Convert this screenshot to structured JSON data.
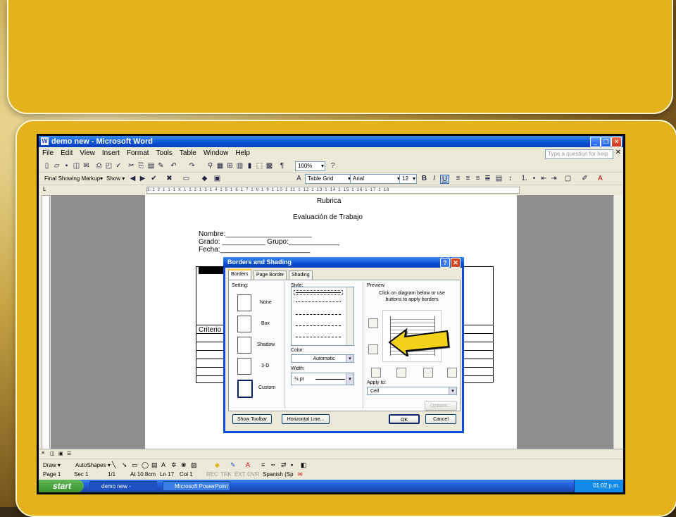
{
  "app": {
    "title": "demo new - Microsoft Word",
    "menu": [
      "File",
      "Edit",
      "View",
      "Insert",
      "Format",
      "Tools",
      "Table",
      "Window",
      "Help"
    ],
    "help_placeholder": "Type a question for help",
    "zoom": "100%",
    "markup_combo": "Final Showing Markup",
    "show_label": "Show ▾",
    "style_combo": "Table Grid",
    "font_combo": "Arial",
    "size_combo": "12",
    "ruler_text": "3·1·2·1·1·1·X·1·1·2·1·3·1·4·1·5·1·6·1·7·1·8·1·9·1·10·1·11·1·12·1·13·1·14·1·15·1·16·1·17·1·18"
  },
  "document": {
    "heading": "Rubrica",
    "subheading": "Evaluación de Trabajo",
    "line_nombre": "Nombre:______________________",
    "line_grado": "Grado: ___________ Grupo:_____________",
    "line_fecha": "Fecha:_______________________",
    "table_cell": "Criterio"
  },
  "dialog": {
    "title": "Borders and Shading",
    "tabs": [
      "Borders",
      "Page Border",
      "Shading"
    ],
    "setting_label": "Setting:",
    "settings": [
      "None",
      "Box",
      "Shadow",
      "3-D",
      "Custom"
    ],
    "style_label": "Style:",
    "color_label": "Color:",
    "color_value": "Automatic",
    "width_label": "Width:",
    "width_value": "½ pt",
    "preview_label": "Preview",
    "preview_help": "Click on diagram below or use buttons to apply borders",
    "apply_label": "Apply to:",
    "apply_value": "Cell",
    "options_button": "Options...",
    "show_toolbar_button": "Show Toolbar",
    "horizontal_line_button": "Horizontal Line...",
    "ok_button": "OK",
    "cancel_button": "Cancel"
  },
  "drawbar": {
    "draw_label": "Draw ▾",
    "autoshapes_label": "AutoShapes ▾"
  },
  "status": {
    "page": "Page 1",
    "sec": "Sec 1",
    "pages": "1/1",
    "at": "At 10.8cm",
    "ln": "Ln 17",
    "col": "Col 1",
    "rec": "REC",
    "trk": "TRK",
    "ext": "EXT",
    "ovr": "OVR",
    "lang": "Spanish (Sp"
  },
  "taskbar": {
    "start": "start",
    "task1": "demo new - Microsoft...",
    "task2": "Microsoft PowerPoint ...",
    "clock": "01:02 p.m."
  },
  "colors": {
    "slide": "#e4b21c",
    "xp_blue": "#0a4ed6",
    "arrow": "#f5d21a"
  }
}
